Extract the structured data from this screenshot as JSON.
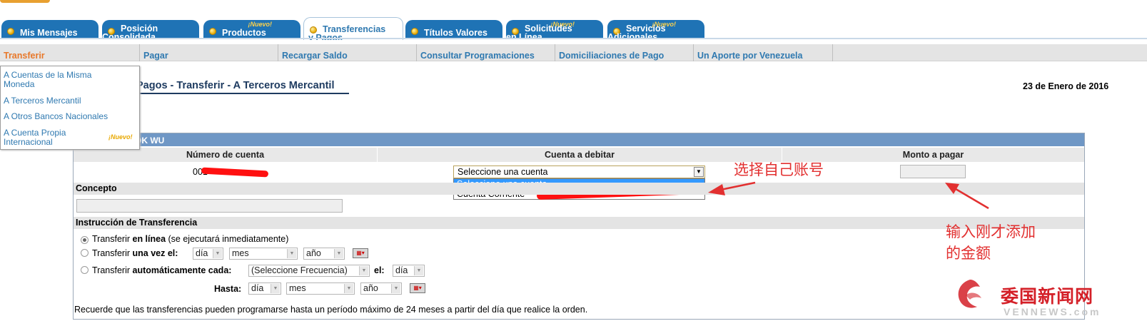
{
  "tabs": [
    {
      "label": "Mis Mensajes",
      "nuevo": ""
    },
    {
      "label": "Posición Consolidada",
      "nuevo": ""
    },
    {
      "label": "Productos",
      "nuevo": "¡Nuevo!"
    },
    {
      "label": "Transferencias y Pagos",
      "nuevo": ""
    },
    {
      "label": "Títulos Valores",
      "nuevo": ""
    },
    {
      "label": "Solicitudes en Línea",
      "nuevo": "¡Nuevo!"
    },
    {
      "label": "Servicios Adicionales",
      "nuevo": "¡Nuevo!"
    }
  ],
  "subnav": [
    "Transferir",
    "Pagar",
    "Recargar Saldo",
    "Consultar Programaciones",
    "Domiciliaciones de Pago",
    "Un Aporte por Venezuela"
  ],
  "dropdown_menu": {
    "items": [
      "A Cuentas de la Misma Moneda",
      "A Terceros Mercantil",
      "A Otros Bancos Nacionales",
      "A Cuenta Propia Internacional"
    ],
    "nuevo_badge": "¡Nuevo!"
  },
  "page": {
    "title": "Pagos - Transferir - A Terceros Mercantil",
    "date": "23 de Enero de 2016"
  },
  "panel": {
    "header": "OK WU",
    "col_numero": "Número de cuenta",
    "col_cuenta": "Cuenta a debitar",
    "col_monto": "Monto a pagar",
    "account_number_prefix": "001",
    "select_value": "Seleccione una cuenta",
    "options": [
      "Seleccione una cuenta",
      "Cuenta Corriente -"
    ],
    "concepto_label": "Concepto",
    "instruccion_label": "Instrucción de Transferencia"
  },
  "instrucciones": {
    "opt1_prefix": "Transferir ",
    "opt1_bold": "en línea",
    "opt1_suffix": " (se ejecutará inmediatamente)",
    "opt2_prefix": "Transferir ",
    "opt2_bold": "una vez el:",
    "opt3_prefix": "Transferir ",
    "opt3_bold": "automáticamente cada:",
    "frecuencia": "(Seleccione Frecuencia)",
    "el_label": "el:",
    "hasta_label": "Hasta:",
    "dia": "día",
    "mes": "mes",
    "anio": "año",
    "note": "Recuerde que las transferencias pueden programarse hasta un período máximo de 24 meses a partir del día que realice la orden."
  },
  "annotations": {
    "select_account": "选择自己账号",
    "enter_amount_line1": "输入刚才添加",
    "enter_amount_line2": "的金额"
  },
  "watermark": {
    "name": "委国新闻网",
    "site": "VENNEWS.com"
  },
  "colors": {
    "tab_blue": "#1f73b5",
    "link_blue": "#2f79b0",
    "active_orange": "#e8782a",
    "panel_header": "#6f97c5",
    "annotation_red": "#e23030"
  }
}
